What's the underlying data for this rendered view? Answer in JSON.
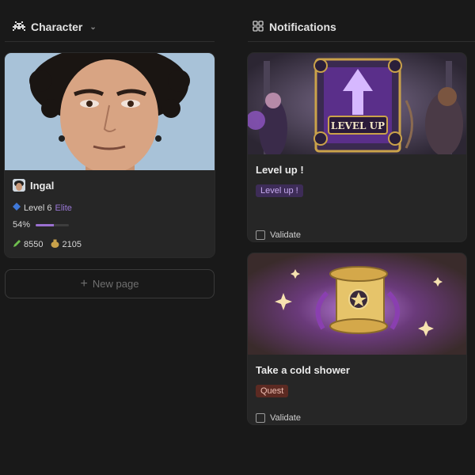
{
  "character_column": {
    "title": "Character",
    "card": {
      "name": "Ingal",
      "level_text": "Level 6",
      "rank": "Elite",
      "progress_label": "54%",
      "progress_value": 0.54,
      "xp": "8550",
      "gold": "2105"
    },
    "new_page_label": "New page"
  },
  "notifications_column": {
    "title": "Notifications",
    "cards": [
      {
        "title": "Level up !",
        "tag": "Level up !",
        "checkbox_label": "Validate",
        "image_caption": "LEVEL UP"
      },
      {
        "title": "Take a cold shower",
        "tag": "Quest",
        "checkbox_label": "Validate"
      }
    ]
  },
  "colors": {
    "background": "#191919",
    "card": "#262626",
    "accent_purple": "#9a78d6",
    "tag_purple_bg": "#3d2c57",
    "tag_red_bg": "#5c2a22"
  },
  "icons": {
    "character_header": "space-invader-icon",
    "notifications_header": "grid-icon",
    "level": "blue-diamond-icon",
    "xp": "pencil-icon",
    "gold": "money-bag-icon"
  }
}
